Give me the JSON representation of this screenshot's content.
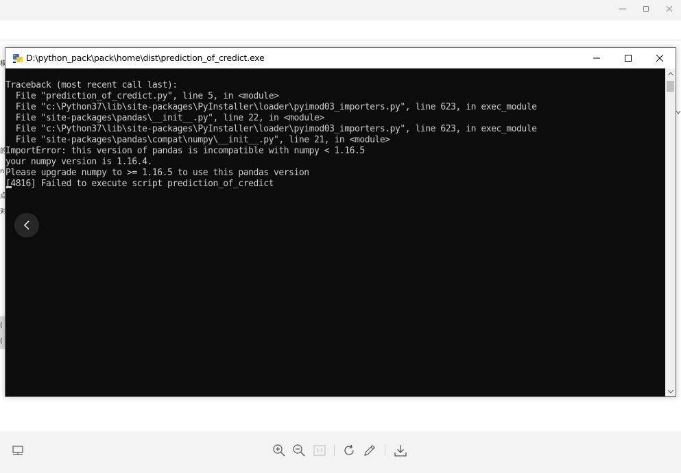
{
  "console": {
    "title": "D:\\python_pack\\pack\\home\\dist\\prediction_of_credict.exe",
    "lines": [
      "Traceback (most recent call last):",
      "  File \"prediction_of_credict.py\", line 5, in <module>",
      "  File \"c:\\Python37\\lib\\site-packages\\PyInstaller\\loader\\pyimod03_importers.py\", line 623, in exec_module",
      "  File \"site-packages\\pandas\\__init__.py\", line 22, in <module>",
      "  File \"c:\\Python37\\lib\\site-packages\\PyInstaller\\loader\\pyimod03_importers.py\", line 623, in exec_module",
      "  File \"site-packages\\pandas\\compat\\numpy\\__init__.py\", line 21, in <module>",
      "ImportError: this version of pandas is incompatible with numpy < 1.16.5",
      "your numpy version is 1.16.4.",
      "Please upgrade numpy to >= 1.16.5 to use this pandas version",
      "[4816] Failed to execute script prediction_of_credict"
    ]
  },
  "background": {
    "edge_chars": [
      "模",
      "的",
      "n",
      "点",
      "对",
      "(",
      "("
    ]
  },
  "icons": {
    "viewer_minimize": "minimize-icon",
    "viewer_maximize": "maximize-icon",
    "viewer_close": "close-icon",
    "prev": "chevron-left-icon",
    "filmstrip": "filmstrip-icon",
    "zoom_in": "zoom-in-icon",
    "zoom_out": "zoom-out-icon",
    "actual_size": "actual-size-icon",
    "rotate": "rotate-icon",
    "edit": "pencil-icon",
    "download": "download-icon"
  },
  "colors": {
    "terminal_bg": "#0c0c0c",
    "terminal_fg": "#cccccc",
    "viewer_bg": "#f3f3f3"
  }
}
